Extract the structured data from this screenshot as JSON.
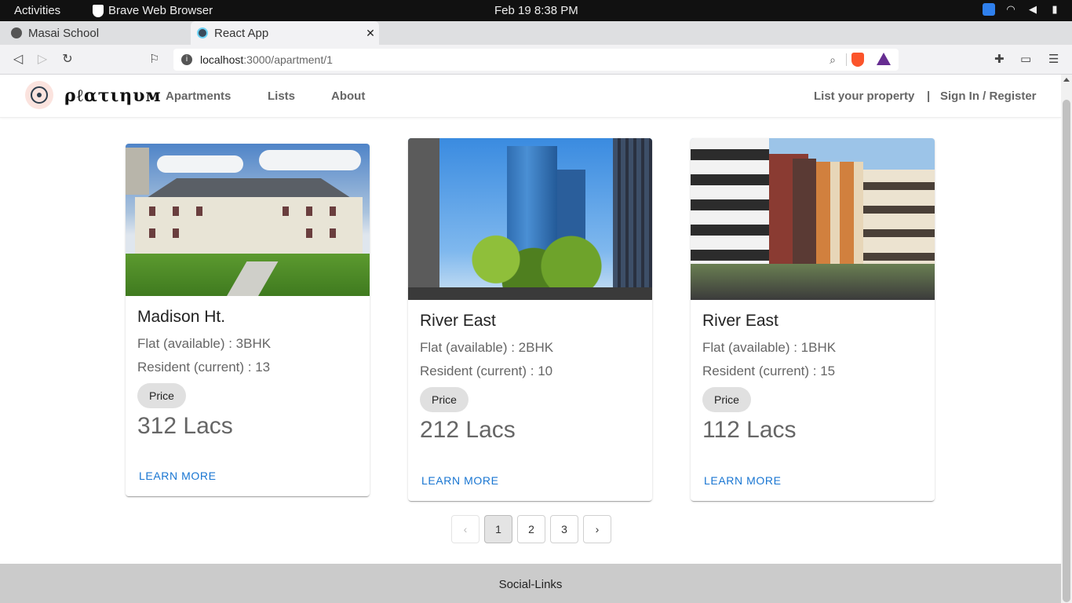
{
  "system_bar": {
    "activities": "Activities",
    "app_name": "Brave Web Browser",
    "datetime": "Feb 19  8:38 PM"
  },
  "browser": {
    "tabs": [
      {
        "label": "Masai School",
        "active": false
      },
      {
        "label": "React App",
        "active": true
      }
    ],
    "new_tab": "+",
    "url_host": "localhost",
    "url_path": ":3000/apartment/1"
  },
  "header": {
    "brand": "ρℓατιηυм",
    "nav": [
      "Apartments",
      "Lists",
      "About"
    ],
    "list_property": "List your property",
    "divider": "|",
    "sign_in": "Sign In / Register"
  },
  "cards": [
    {
      "title": "Madison Ht.",
      "flat": "Flat (available) : 3BHK",
      "resident": "Resident (current) : 13",
      "price_chip": "Price",
      "price": "312 Lacs",
      "cta": "LEARN MORE"
    },
    {
      "title": "River East",
      "flat": "Flat (available) : 2BHK",
      "resident": "Resident (current) : 10",
      "price_chip": "Price",
      "price": "212 Lacs",
      "cta": "LEARN MORE"
    },
    {
      "title": "River East",
      "flat": "Flat (available) : 1BHK",
      "resident": "Resident (current) : 15",
      "price_chip": "Price",
      "price": "112 Lacs",
      "cta": "LEARN MORE"
    }
  ],
  "pagination": {
    "pages": [
      "1",
      "2",
      "3"
    ],
    "current": "1",
    "prev_icon": "chevron-left-icon",
    "next_icon": "chevron-right-icon"
  },
  "footer": {
    "text": "Social-Links"
  },
  "colors": {
    "link": "#1976d2",
    "footer_bg": "#cbcbcb",
    "chip_bg": "#e0e0e0"
  }
}
